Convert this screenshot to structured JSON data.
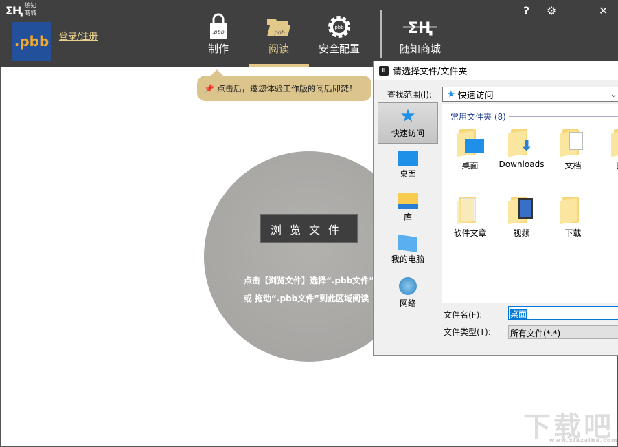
{
  "header": {
    "brand_logo": "SUI ZHI",
    "brand_line1": "随知",
    "brand_line2": "商城",
    "app_logo": ".pbb",
    "login": "登录/注册",
    "nav": [
      {
        "label": "制作",
        "icon": "lock-pbb-icon"
      },
      {
        "label": "阅读",
        "icon": "folder-pbb-icon",
        "active": true
      },
      {
        "label": "安全配置",
        "icon": "gear-pbb-icon"
      },
      {
        "label": "随知商城",
        "icon": "suizhi-logo-icon"
      }
    ],
    "controls": {
      "help": "?",
      "settings": "⚙",
      "close": "✕"
    }
  },
  "tip": "点击后，邀您体验工作版的阅后即焚！",
  "main": {
    "browse_label": "浏览文件",
    "hint_line1": "点击【浏览文件】选择“.pbb文件”",
    "hint_line2": "或 拖动“.pbb文件”到此区域阅读"
  },
  "dialog": {
    "title": "请选择文件/文件夹",
    "lookin_label": "查找范围(I):",
    "lookin_value": "快速访问",
    "places": [
      {
        "label": "快速访问",
        "icon": "star-icon",
        "selected": true
      },
      {
        "label": "桌面",
        "icon": "desktop-icon"
      },
      {
        "label": "库",
        "icon": "library-icon"
      },
      {
        "label": "我的电脑",
        "icon": "computer-icon"
      },
      {
        "label": "网络",
        "icon": "network-icon"
      }
    ],
    "group": "常用文件夹 (8)",
    "items": [
      {
        "label": "桌面"
      },
      {
        "label": "Downloads"
      },
      {
        "label": "文档"
      },
      {
        "label": "图片"
      },
      {
        "label": "软件文章"
      },
      {
        "label": "视频"
      },
      {
        "label": "下载"
      }
    ],
    "filename_label": "文件名(F):",
    "filename_value": "桌面",
    "filetype_label": "文件类型(T):",
    "filetype_value": "所有文件(*.*)"
  },
  "watermark": {
    "text": "下载吧",
    "url": "www.xiazaiba.com"
  }
}
